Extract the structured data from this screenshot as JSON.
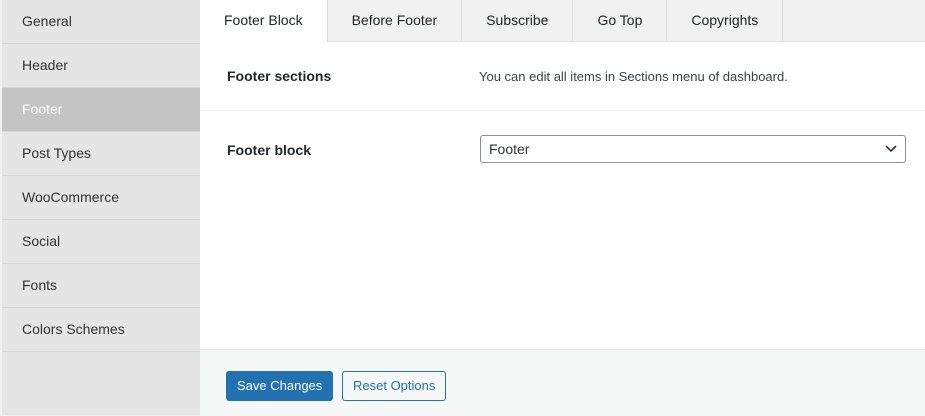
{
  "sidebar": {
    "items": [
      {
        "label": "General"
      },
      {
        "label": "Header"
      },
      {
        "label": "Footer"
      },
      {
        "label": "Post Types"
      },
      {
        "label": "WooCommerce"
      },
      {
        "label": "Social"
      },
      {
        "label": "Fonts"
      },
      {
        "label": "Colors Schemes"
      }
    ],
    "active": "Footer"
  },
  "tabs": [
    {
      "label": "Footer Block"
    },
    {
      "label": "Before Footer"
    },
    {
      "label": "Subscribe"
    },
    {
      "label": "Go Top"
    },
    {
      "label": "Copyrights"
    }
  ],
  "active_tab": "Footer Block",
  "settings": {
    "footer_sections": {
      "label": "Footer sections",
      "description": "You can edit all items in Sections menu of dashboard."
    },
    "footer_block": {
      "label": "Footer block",
      "selected": "Footer"
    }
  },
  "actions": {
    "save_label": "Save Changes",
    "reset_label": "Reset Options"
  },
  "colors": {
    "primary": "#2271b1",
    "sidebar_active": "#c4c4c4"
  },
  "icons": {
    "select_arrow": "chevron-down-icon"
  }
}
